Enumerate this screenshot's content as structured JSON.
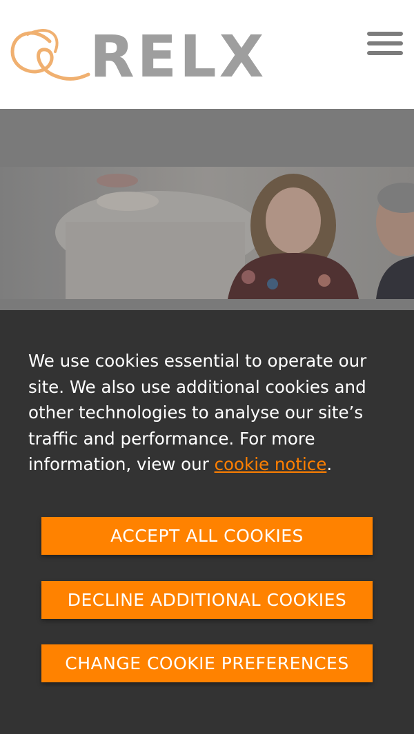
{
  "header": {
    "logo_text": "RELX",
    "menu_icon": "hamburger-menu-icon"
  },
  "cookie_banner": {
    "message_before_link": "We use cookies essential to operate our site. We also use additional cookies and other technologies to analyse our site’s traffic and performance. For more information, view our ",
    "link_text": "cookie notice",
    "message_after_link": ".",
    "accept_label": "ACCEPT ALL COOKIES",
    "decline_label": "DECLINE ADDITIONAL COOKIES",
    "preferences_label": "CHANGE COOKIE PREFERENCES"
  },
  "colors": {
    "accent": "#ff8200",
    "panel_bg": "#333333",
    "logo_gray": "#9e9e9e",
    "logo_orange": "#f0b070"
  }
}
